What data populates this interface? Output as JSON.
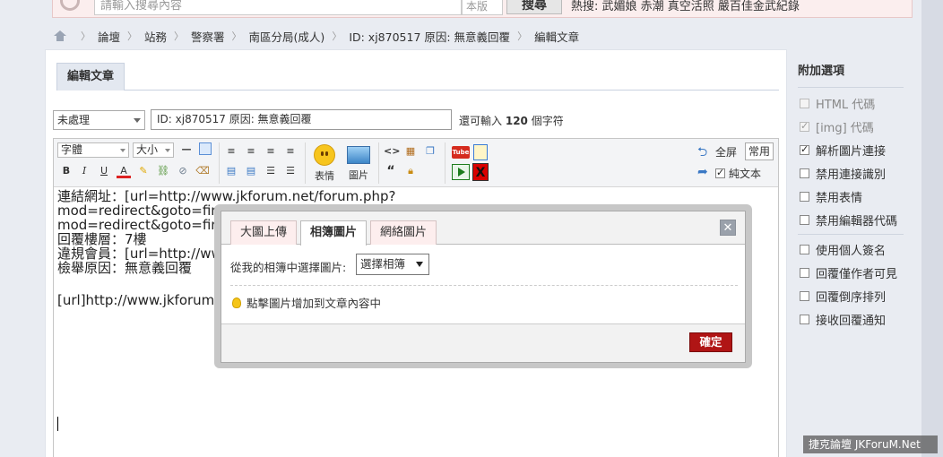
{
  "topbar": {
    "search_placeholder": "請輸入搜尋內容",
    "scope": "本版",
    "search_button": "搜尋",
    "hot_text": "熱搜: 武媚娘  赤潮  真空活照  嚴百佳金武紀錄"
  },
  "breadcrumb": [
    "論壇",
    "站務",
    "警察署",
    "南區分局(成人)",
    "ID: xj870517 原因: 無意義回覆",
    "編輯文章"
  ],
  "main": {
    "tab_label": "編輯文章",
    "status_value": "未處理",
    "title_value": "ID: xj870517 原因: 無意義回覆",
    "remain_prefix": "還可輸入",
    "remain_count": "120",
    "remain_suffix": "個字符"
  },
  "toolbar": {
    "font_select": "字體",
    "size_select": "大小",
    "emoticon_label": "表情",
    "image_label": "圖片",
    "tube_text": "Tube",
    "fullscreen_label": "全屏",
    "common_label": "常用",
    "plain_text_label": "純文本",
    "plain_text_checked": true
  },
  "editor": {
    "lines": [
      "連結網址：[url=http://www.jkforum.net/forum.php?",
      "mod=redirect&goto=findpost&ptid=54779146&pid=78198858]http://www.jkforum.net/forum.php?",
      "mod=redirect&goto=findpost&ptid=54779146&pid=78198858[/url]",
      "回覆樓層：7樓",
      "違規會員：[url=http://www.jkforum.net/home.php?mod=space&uid=1111]xj870517[/url]",
      "檢舉原因：無意義回覆",
      "",
      "[url]http://www.jkforum.net/forum.php?mod=viewthread&tid=54779146[/url]"
    ]
  },
  "dialog": {
    "tabs": [
      "大圖上傳",
      "相簿圖片",
      "網絡圖片"
    ],
    "active_tab": 1,
    "album_label": "從我的相簿中選擇圖片:",
    "album_select": "選擇相簿",
    "tip": "點擊圖片增加到文章內容中",
    "close_symbol": "✕",
    "ok_label": "確定"
  },
  "sidebar": {
    "title": "附加選項",
    "group1": [
      {
        "label": "HTML 代碼",
        "checked": false,
        "disabled": true
      },
      {
        "label": "[img] 代碼",
        "checked": true,
        "disabled": true
      },
      {
        "label": "解析圖片連接",
        "checked": true,
        "disabled": false
      },
      {
        "label": "禁用連接識別",
        "checked": false,
        "disabled": false
      },
      {
        "label": "禁用表情",
        "checked": false,
        "disabled": false
      },
      {
        "label": "禁用編輯器代碼",
        "checked": false,
        "disabled": false
      }
    ],
    "group2": [
      {
        "label": "使用個人簽名",
        "checked": false,
        "disabled": false
      },
      {
        "label": "回覆僅作者可見",
        "checked": false,
        "disabled": false
      },
      {
        "label": "回覆倒序排列",
        "checked": false,
        "disabled": false
      },
      {
        "label": "接收回覆通知",
        "checked": false,
        "disabled": false
      }
    ]
  },
  "watermark": "捷克論壇 JKForuM.Net",
  "colors": {
    "ok_button": "#b01515",
    "topbar_bg": "#fbeeee",
    "link_underline": "#dd3333"
  }
}
